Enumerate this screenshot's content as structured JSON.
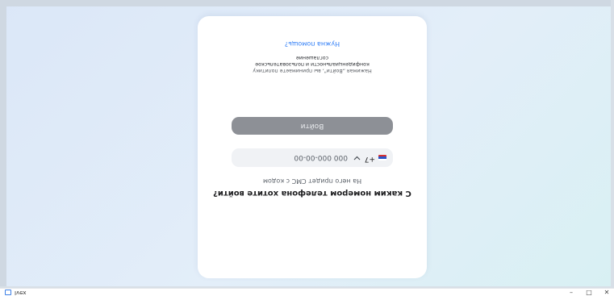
{
  "login": {
    "title": "С каким номером телефона хотите войти?",
    "subtitle": "На него придет СМС с кодом",
    "country_code": "+7",
    "phone_placeholder": "000 000-00-00",
    "login_button": "Войти",
    "consent_line1": "Нажимая „Войти\", вы принимаете политику",
    "consent_line2": "конфиденциальности и пользовательское",
    "consent_line3": "соглашение",
    "help_link": "Нужна помощь?"
  },
  "taskbar": {
    "app_name": "Ivex",
    "minimize_symbol": "–",
    "maximize_symbol": "□",
    "close_symbol": "✕"
  },
  "colors": {
    "accent_link": "#2f7df6",
    "button_bg": "#8d9096",
    "background_gradient": [
      "#d8f0f3",
      "#dbe7f8"
    ]
  },
  "icons": [
    "russia-flag-icon",
    "chevron-down-icon",
    "app-icon"
  ]
}
